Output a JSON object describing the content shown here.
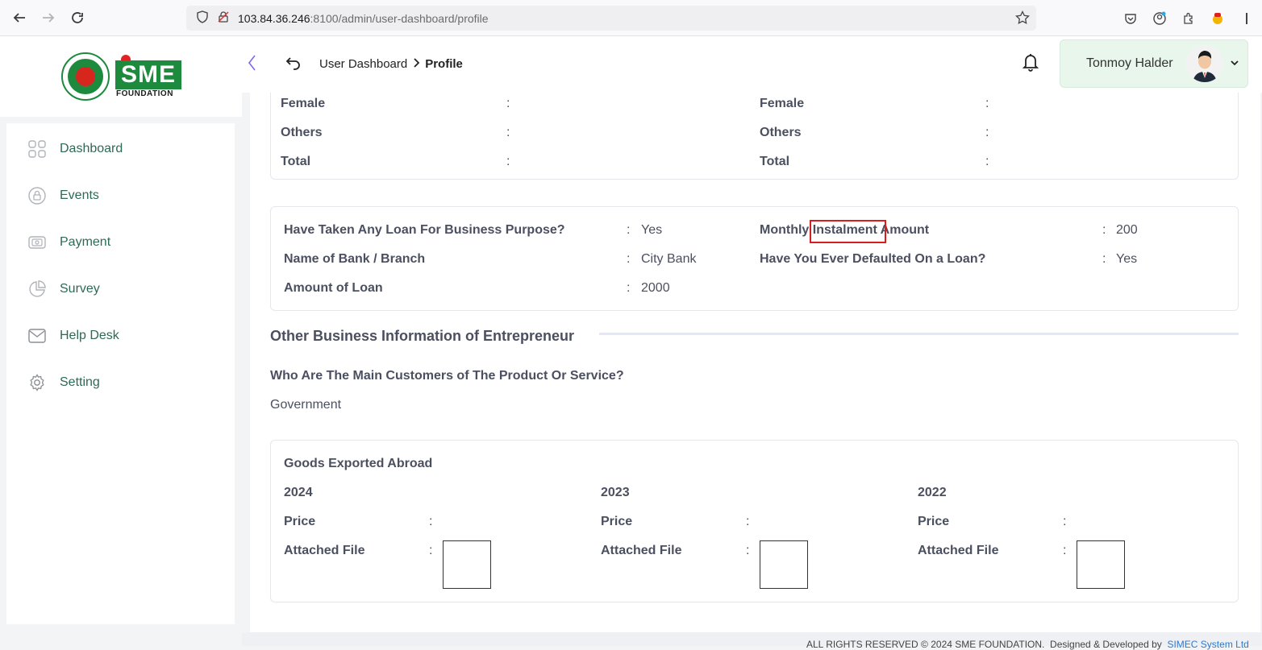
{
  "browser": {
    "url_host": "103.84.36.246",
    "url_path": ":8100/admin/user-dashboard/profile"
  },
  "logo": {
    "brand_letters": "SME",
    "sub": "FOUNDATION"
  },
  "header": {
    "breadcrumb_parent": "User Dashboard",
    "breadcrumb_current": "Profile",
    "user_name": "Tonmoy Halder"
  },
  "sidebar": {
    "items": [
      {
        "label": "Dashboard",
        "icon": "grid-icon"
      },
      {
        "label": "Events",
        "icon": "lock-icon"
      },
      {
        "label": "Payment",
        "icon": "money-icon"
      },
      {
        "label": "Survey",
        "icon": "pie-chart-icon"
      },
      {
        "label": "Help Desk",
        "icon": "mail-icon"
      },
      {
        "label": "Setting",
        "icon": "gear-icon"
      }
    ]
  },
  "employees": {
    "left": [
      {
        "label": "Female",
        "value": ""
      },
      {
        "label": "Others",
        "value": ""
      },
      {
        "label": "Total",
        "value": ""
      }
    ],
    "right": [
      {
        "label": "Female",
        "value": ""
      },
      {
        "label": "Others",
        "value": ""
      },
      {
        "label": "Total",
        "value": ""
      }
    ]
  },
  "loan": {
    "taken_label": "Have Taken Any Loan For Business Purpose?",
    "taken_value": "Yes",
    "bank_label": "Name of Bank / Branch",
    "bank_value": "City Bank",
    "amount_label": "Amount of Loan",
    "amount_value": "2000",
    "instalment_label_a": "Monthly",
    "instalment_label_b": "Instalment",
    "instalment_label_c": "Amount",
    "instalment_value": "200",
    "default_label": "Have You Ever Defaulted On a Loan?",
    "default_value": "Yes"
  },
  "other_business": {
    "title": "Other Business Information of Entrepreneur",
    "customers_label": "Who Are The Main Customers of The Product Or Service?",
    "customers_value": "Government"
  },
  "exports": {
    "title": "Goods Exported Abroad",
    "price_label": "Price",
    "file_label": "Attached File",
    "years": [
      {
        "year": "2024",
        "price": ""
      },
      {
        "year": "2023",
        "price": ""
      },
      {
        "year": "2022",
        "price": ""
      }
    ]
  },
  "footer": {
    "rights": "ALL RIGHTS RESERVED © 2024 SME FOUNDATION.",
    "designed": "Designed & Developed by",
    "company": "SIMEC System Ltd"
  }
}
